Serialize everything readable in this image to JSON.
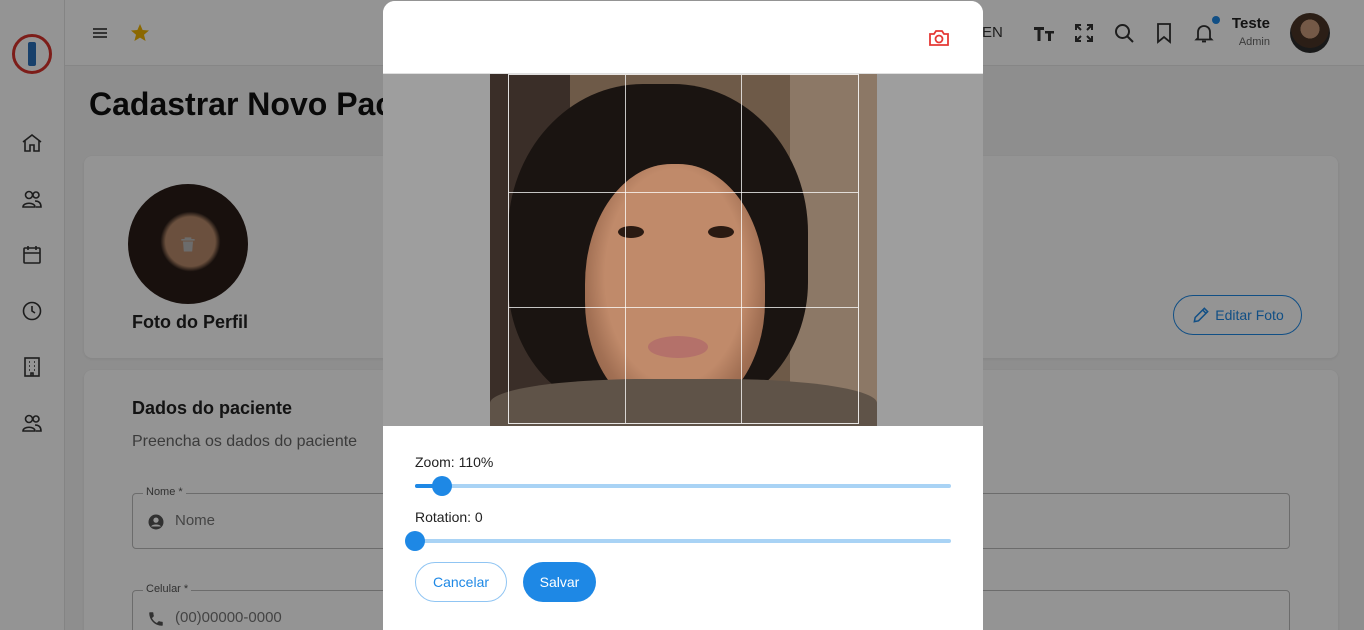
{
  "topbar": {
    "language": "EN",
    "user_name": "Teste",
    "user_role": "Admin"
  },
  "page": {
    "title": "Cadastrar Novo Paciente",
    "photo_card": {
      "label": "Foto do Perfil",
      "edit_button": "Editar Foto"
    },
    "patient_card": {
      "title": "Dados do paciente",
      "subtitle": "Preencha os dados do paciente",
      "fields": [
        {
          "label": "Nome *",
          "placeholder": "Nome",
          "icon": "person-icon"
        },
        {
          "label": "Celular *",
          "placeholder": "(00)00000-0000",
          "icon": "phone-icon"
        }
      ]
    }
  },
  "dialog": {
    "zoom_label": "Zoom: 110%",
    "zoom_fraction": 0.05,
    "rotation_label": "Rotation: 0",
    "rotation_fraction": 0,
    "cancel_button": "Cancelar",
    "save_button": "Salvar"
  },
  "colors": {
    "primary": "#1e88e5",
    "brand_red": "#d8322b",
    "camera_icon": "#e53935"
  },
  "icons": {
    "sidebar": [
      "home-icon",
      "patients-icon",
      "calendar-icon",
      "clock-icon",
      "building-icon",
      "users-icon"
    ],
    "topbar": [
      "menu-icon",
      "star-icon",
      "text-size-icon",
      "fullscreen-icon",
      "search-icon",
      "bookmark-icon",
      "bell-icon"
    ]
  }
}
